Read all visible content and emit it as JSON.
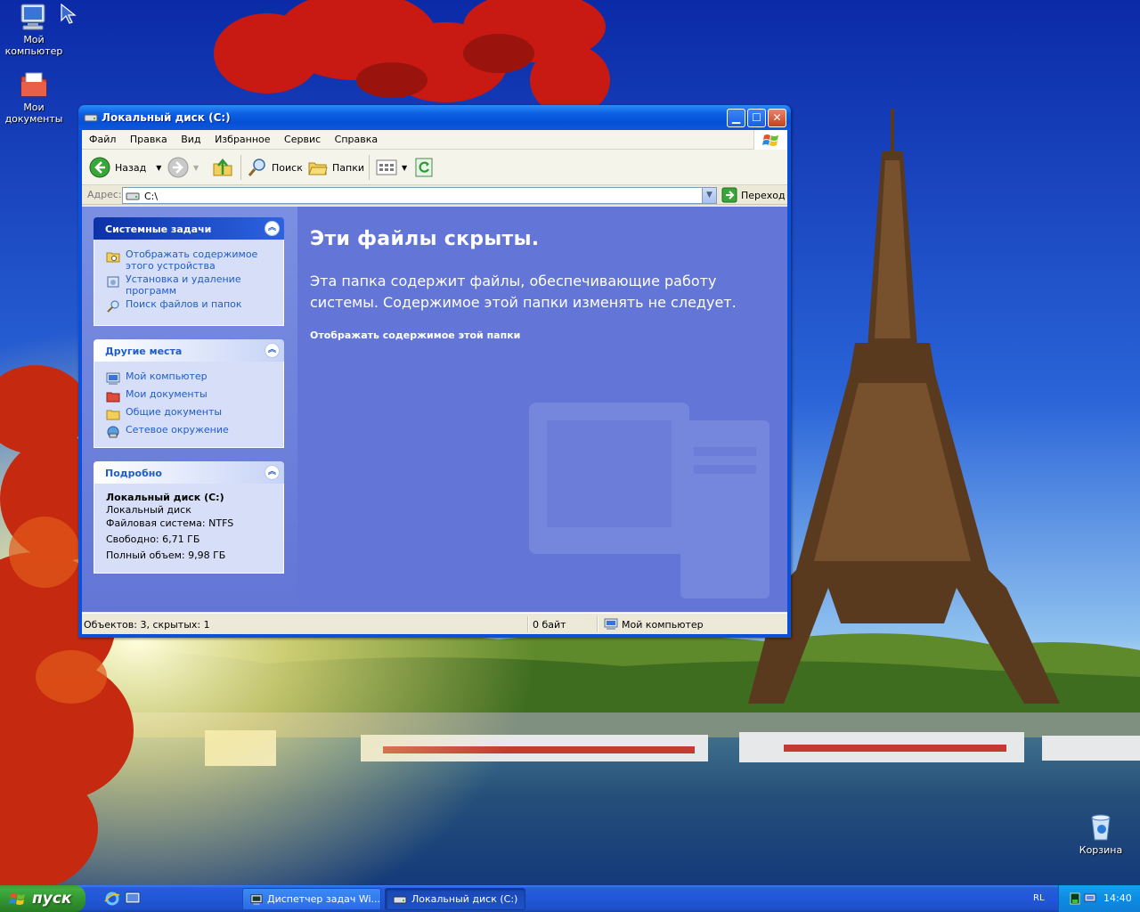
{
  "desktop": {
    "icons": [
      {
        "label": "Мой компьютер",
        "icon": "my-computer-icon"
      },
      {
        "label": "Мои документы",
        "icon": "my-documents-icon"
      },
      {
        "label": "Корзина",
        "icon": "recycle-bin-icon"
      }
    ]
  },
  "window": {
    "title": "Локальный диск (C:)",
    "menu": [
      "Файл",
      "Правка",
      "Вид",
      "Избранное",
      "Сервис",
      "Справка"
    ],
    "toolbar": {
      "back_label": "Назад",
      "search_label": "Поиск",
      "folders_label": "Папки"
    },
    "address": {
      "label": "Адрес:",
      "value": "C:\\",
      "go_label": "Переход"
    },
    "task_pane": {
      "system_tasks": {
        "title": "Системные задачи",
        "items": [
          {
            "label": "Отображать содержимое этого устройства",
            "icon": "folder-view-icon"
          },
          {
            "label": "Установка и удаление программ",
            "icon": "add-remove-programs-icon"
          },
          {
            "label": "Поиск файлов и папок",
            "icon": "search-icon"
          }
        ]
      },
      "other_places": {
        "title": "Другие места",
        "items": [
          {
            "label": "Мой компьютер",
            "icon": "my-computer-icon"
          },
          {
            "label": "Мои документы",
            "icon": "my-documents-icon"
          },
          {
            "label": "Общие документы",
            "icon": "shared-documents-icon"
          },
          {
            "label": "Сетевое окружение",
            "icon": "network-places-icon"
          }
        ]
      },
      "details": {
        "title": "Подробно",
        "name": "Локальный диск (C:)",
        "type": "Локальный диск",
        "filesystem": "Файловая система: NTFS",
        "free": "Свободно: 6,71 ГБ",
        "total": "Полный объем: 9,98 ГБ"
      }
    },
    "main": {
      "heading": "Эти файлы скрыты.",
      "message": "Эта папка содержит файлы, обеспечивающие работу системы. Содержимое этой папки изменять не следует.",
      "show_link": "Отображать содержимое этой папки"
    },
    "status": {
      "objects": "Объектов: 3, скрытых: 1",
      "size": "0 байт",
      "location": "Мой компьютер"
    }
  },
  "taskbar": {
    "start_label": "пуск",
    "tasks": [
      {
        "label": "Диспетчер задач Wi...",
        "active": false
      },
      {
        "label": "Локальный диск (C:)",
        "active": true
      }
    ],
    "language": "RL",
    "clock": "14:40"
  },
  "colors": {
    "sky": "#1d4fc8",
    "content_bg": "#6375d6",
    "panel_link": "#215dc6",
    "titlebar": "#0a50d8",
    "start_green": "#3fae3f"
  }
}
